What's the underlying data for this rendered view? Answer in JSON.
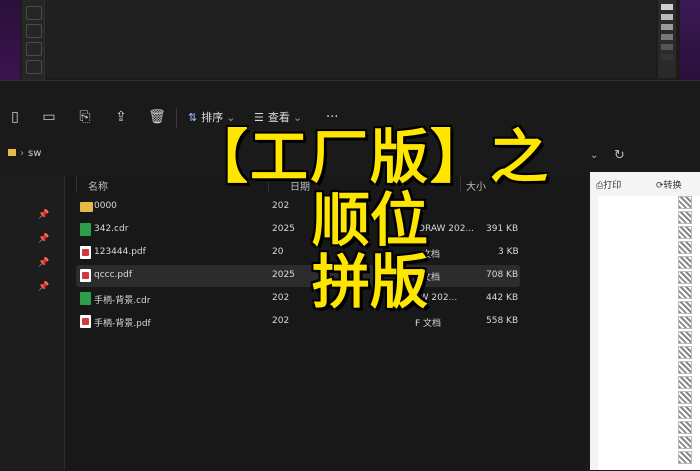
{
  "overlay": {
    "line1": "【工厂版】之",
    "line2": "顺位",
    "line3": "拼版"
  },
  "toolbar": {
    "sort_label": "排序",
    "view_label": "查看",
    "more_label": "···"
  },
  "address": {
    "path": "sw"
  },
  "headers": {
    "name": "名称",
    "date": "日期",
    "size": "大小"
  },
  "files": [
    {
      "name": "0000",
      "date": "202",
      "type": "",
      "size": "",
      "icon": "folder-icon"
    },
    {
      "name": "342.cdr",
      "date": "2025",
      "type": "elDRAW 202...",
      "size": "391 KB",
      "icon": "cdr-file-icon"
    },
    {
      "name": "123444.pdf",
      "date": "20",
      "type": "文档",
      "size": "3 KB",
      "icon": "pdf-file-icon"
    },
    {
      "name": "qccc.pdf",
      "date": "2025",
      "type": "文档",
      "size": "708 KB",
      "icon": "pdf-file-icon"
    },
    {
      "name": "手柄-背景.cdr",
      "date": "202",
      "type": "AW 202...",
      "size": "442 KB",
      "icon": "cdr-file-icon"
    },
    {
      "name": "手柄-背景.pdf",
      "date": "202",
      "type": "F 文档",
      "size": "558 KB",
      "icon": "pdf-file-icon"
    }
  ],
  "preview": {
    "print_label": "打印",
    "convert_label": "转换"
  },
  "colors": {
    "overlay_text": "#ffe600",
    "background": "#1a1a1a"
  }
}
